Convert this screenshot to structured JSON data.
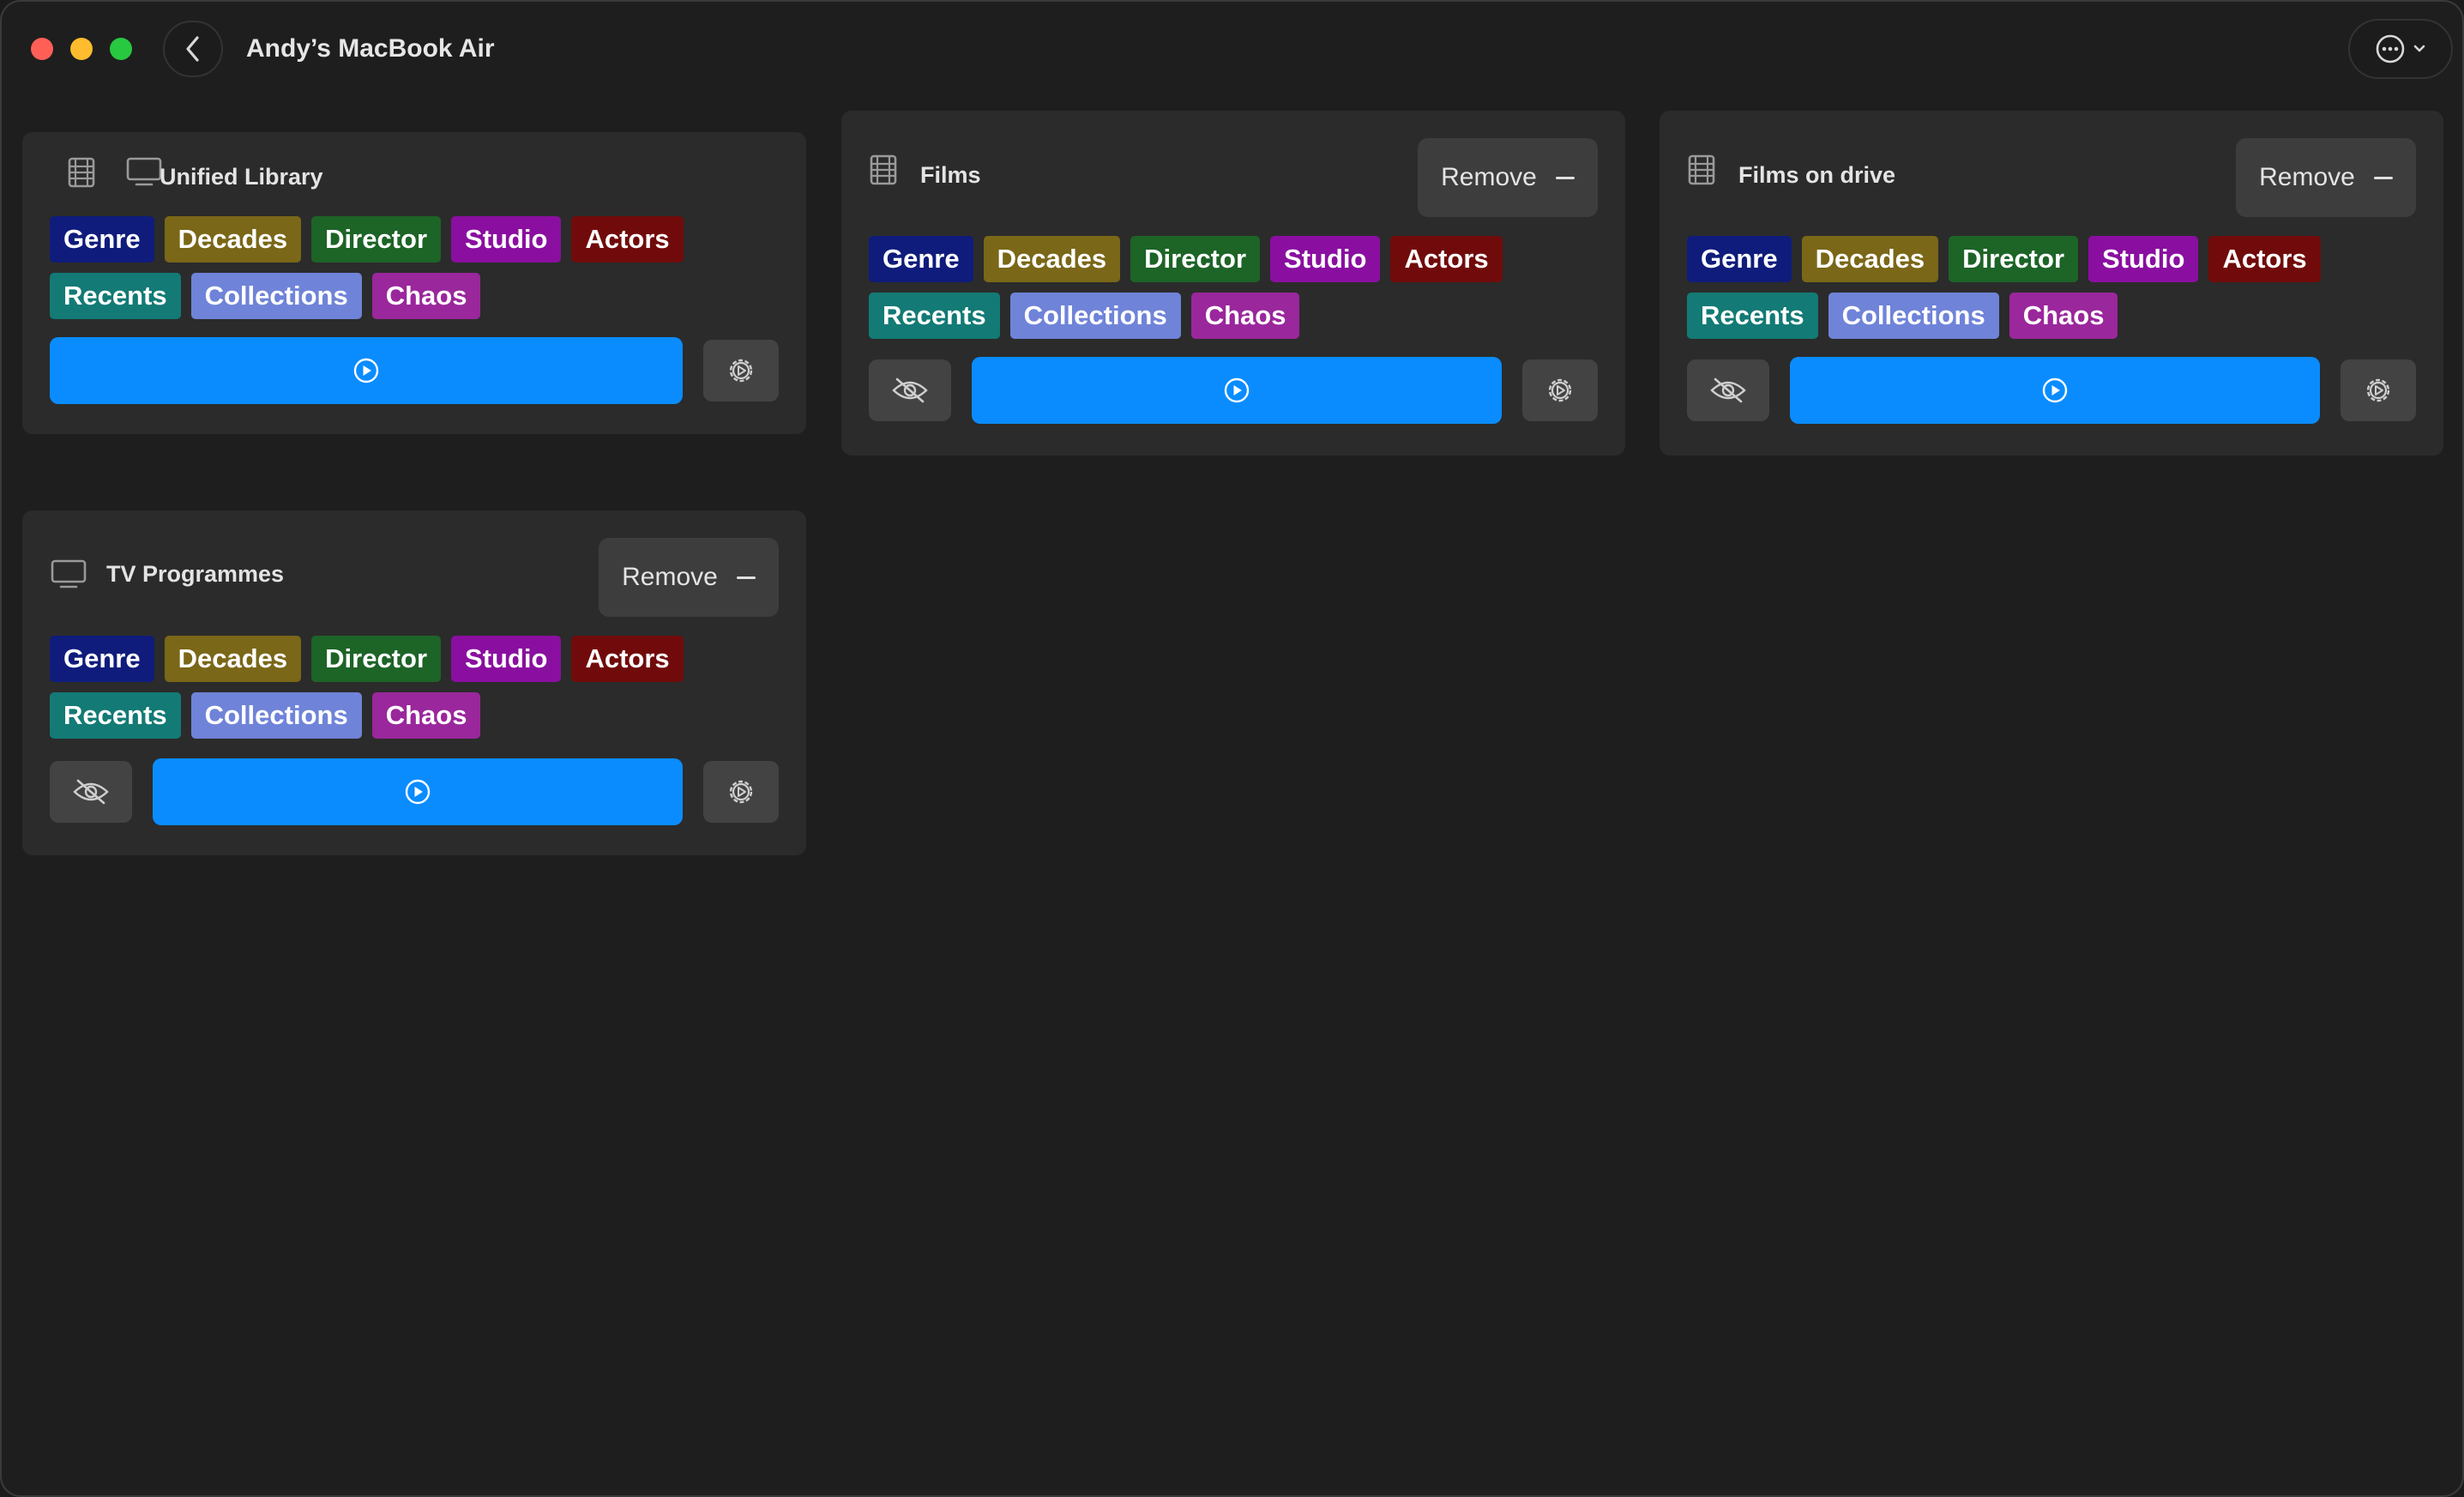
{
  "window": {
    "title": "Andy’s MacBook Air",
    "traffic_lights": {
      "close": "#ff5f57",
      "minimize": "#febc2e",
      "zoom": "#28c840"
    },
    "back_icon": "chevron-left-icon",
    "more_icon": "ellipsis-circle-icon"
  },
  "tag_colors": {
    "Genre": "#0f1c7c",
    "Decades": "#7a6718",
    "Director": "#1d6427",
    "Studio": "#8a0fa0",
    "Actors": "#710b0b",
    "Recents": "#137a75",
    "Collections": "#6f83d8",
    "Chaos": "#9a279c"
  },
  "accent": "#0a8cff",
  "cards": [
    {
      "id": "unified",
      "title": "Unified Library",
      "icons": [
        "film-icon",
        "tv-icon"
      ],
      "remove_label": "",
      "tags_row1": [
        "Genre",
        "Decades",
        "Director",
        "Studio",
        "Actors"
      ],
      "tags_row2": [
        "Recents",
        "Collections",
        "Chaos"
      ],
      "controls": [
        "play-icon",
        "settings-icon"
      ]
    },
    {
      "id": "films",
      "title": "Films",
      "icons": [
        "film-icon"
      ],
      "remove_label": "Remove",
      "tags_row1": [
        "Genre",
        "Decades",
        "Director",
        "Studio",
        "Actors"
      ],
      "tags_row2": [
        "Recents",
        "Collections",
        "Chaos"
      ],
      "controls": [
        "eye-slash-icon",
        "play-icon",
        "settings-icon"
      ]
    },
    {
      "id": "films-drive",
      "title": "Films on drive",
      "icons": [
        "film-icon"
      ],
      "remove_label": "Remove",
      "tags_row1": [
        "Genre",
        "Decades",
        "Director",
        "Studio",
        "Actors"
      ],
      "tags_row2": [
        "Recents",
        "Collections",
        "Chaos"
      ],
      "controls": [
        "eye-slash-icon",
        "play-icon",
        "settings-icon"
      ]
    },
    {
      "id": "tv",
      "title": "TV Programmes",
      "icons": [
        "tv-icon"
      ],
      "remove_label": "Remove",
      "tags_row1": [
        "Genre",
        "Decades",
        "Director",
        "Studio",
        "Actors"
      ],
      "tags_row2": [
        "Recents",
        "Collections",
        "Chaos"
      ],
      "controls": [
        "eye-slash-icon",
        "play-icon",
        "settings-icon"
      ]
    }
  ]
}
